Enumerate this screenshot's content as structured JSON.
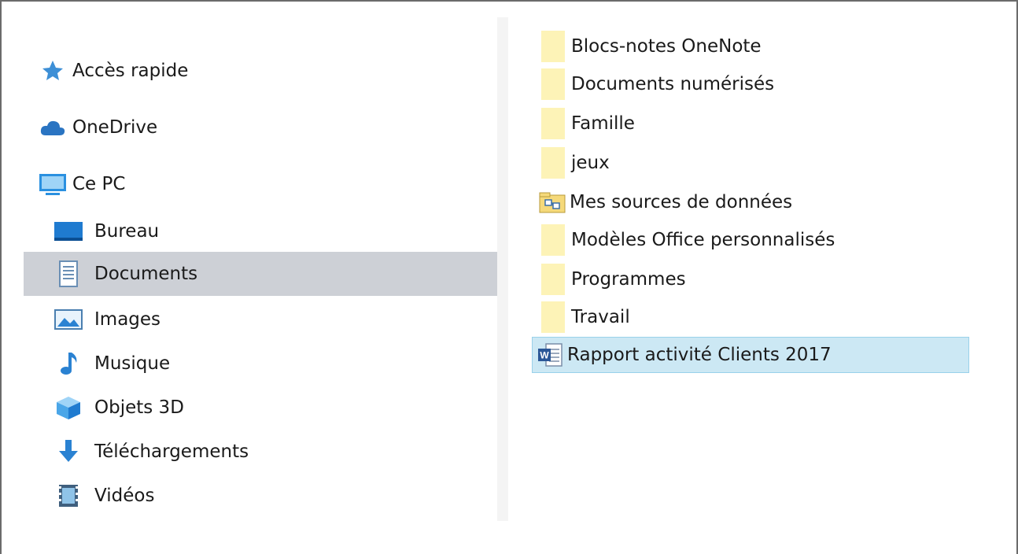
{
  "navigation": {
    "items": [
      {
        "label": "Accès rapide",
        "icon": "star-icon"
      },
      {
        "label": "OneDrive",
        "icon": "cloud-icon"
      },
      {
        "label": "Ce PC",
        "icon": "computer-icon"
      },
      {
        "label": "Bureau",
        "icon": "desktop-icon"
      },
      {
        "label": "Documents",
        "icon": "document-icon",
        "selected": true
      },
      {
        "label": "Images",
        "icon": "image-icon"
      },
      {
        "label": "Musique",
        "icon": "music-note-icon"
      },
      {
        "label": "Objets 3D",
        "icon": "cube-icon"
      },
      {
        "label": "Téléchargements",
        "icon": "download-arrow-icon"
      },
      {
        "label": "Vidéos",
        "icon": "video-icon"
      }
    ]
  },
  "content": {
    "items": [
      {
        "label": "Blocs-notes OneNote",
        "type": "folder"
      },
      {
        "label": "Documents numérisés",
        "type": "folder"
      },
      {
        "label": "Famille",
        "type": "folder"
      },
      {
        "label": "jeux",
        "type": "folder"
      },
      {
        "label": "Mes sources de données",
        "type": "data-source-folder"
      },
      {
        "label": "Modèles Office personnalisés",
        "type": "folder"
      },
      {
        "label": "Programmes",
        "type": "folder"
      },
      {
        "label": "Travail",
        "type": "folder"
      },
      {
        "label": "Rapport activité Clients 2017",
        "type": "word-document",
        "selected": true
      }
    ]
  },
  "colors": {
    "nav_selected": "#cdd0d6",
    "file_selected": "#cce8f4",
    "folder": "#fdf3b7"
  }
}
